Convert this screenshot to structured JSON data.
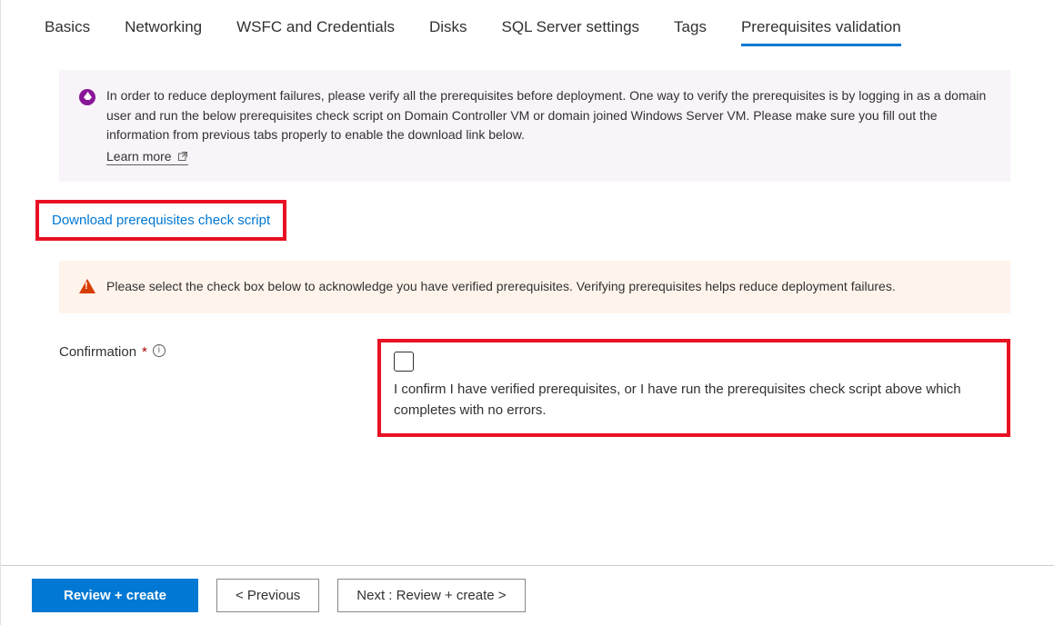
{
  "tabs": [
    {
      "label": "Basics"
    },
    {
      "label": "Networking"
    },
    {
      "label": "WSFC and Credentials"
    },
    {
      "label": "Disks"
    },
    {
      "label": "SQL Server settings"
    },
    {
      "label": "Tags"
    },
    {
      "label": "Prerequisites validation",
      "active": true
    }
  ],
  "info_banner": {
    "text": "In order to reduce deployment failures, please verify all the prerequisites before deployment. One way to verify the prerequisites is by logging in as a domain user and run the below prerequisites check script on Domain Controller VM or domain joined Windows Server VM. Please make sure you fill out the information from previous tabs properly to enable the download link below.",
    "learn_more": "Learn more"
  },
  "download_link": "Download prerequisites check script",
  "warning_banner": {
    "text": "Please select the check box below to acknowledge you have verified prerequisites. Verifying prerequisites helps reduce deployment failures."
  },
  "confirmation": {
    "label": "Confirmation",
    "text": "I confirm I have verified prerequisites, or I have run the prerequisites check script above which completes with no errors."
  },
  "footer": {
    "primary": "Review + create",
    "previous": "< Previous",
    "next": "Next : Review + create >"
  }
}
